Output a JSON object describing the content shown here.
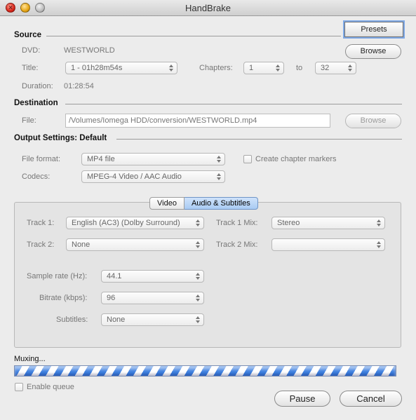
{
  "window": {
    "title": "HandBrake"
  },
  "source": {
    "heading": "Source",
    "dvd_label": "DVD:",
    "dvd_value": "WESTWORLD",
    "title_label": "Title:",
    "title_value": "1 - 01h28m54s",
    "chapters_label": "Chapters:",
    "chapter_start": "1",
    "to_label": "to",
    "chapter_end": "32",
    "duration_label": "Duration:",
    "duration_value": "01:28:54",
    "browse_label": "Browse",
    "presets_label": "Presets"
  },
  "destination": {
    "heading": "Destination",
    "file_label": "File:",
    "file_value": "/Volumes/Iomega HDD/conversion/WESTWORLD.mp4",
    "browse_label": "Browse"
  },
  "output": {
    "heading": "Output Settings: Default",
    "format_label": "File format:",
    "format_value": "MP4 file",
    "chapter_markers_label": "Create chapter markers",
    "codecs_label": "Codecs:",
    "codecs_value": "MPEG-4 Video / AAC Audio"
  },
  "tabs": {
    "video": "Video",
    "audio": "Audio & Subtitles"
  },
  "audio": {
    "track1_label": "Track 1:",
    "track1_value": "English (AC3) (Dolby Surround)",
    "track1_mix_label": "Track 1 Mix:",
    "track1_mix_value": "Stereo",
    "track2_label": "Track 2:",
    "track2_value": "None",
    "track2_mix_label": "Track 2 Mix:",
    "track2_mix_value": "",
    "samplerate_label": "Sample rate (Hz):",
    "samplerate_value": "44.1",
    "bitrate_label": "Bitrate (kbps):",
    "bitrate_value": "96",
    "subtitles_label": "Subtitles:",
    "subtitles_value": "None"
  },
  "status": {
    "text": "Muxing...",
    "progress_indeterminate": true,
    "enable_queue_label": "Enable queue",
    "pause_label": "Pause",
    "cancel_label": "Cancel"
  },
  "colors": {
    "progress_accent": "#3d7fe0",
    "selected_tab": "#a9cbf3"
  }
}
